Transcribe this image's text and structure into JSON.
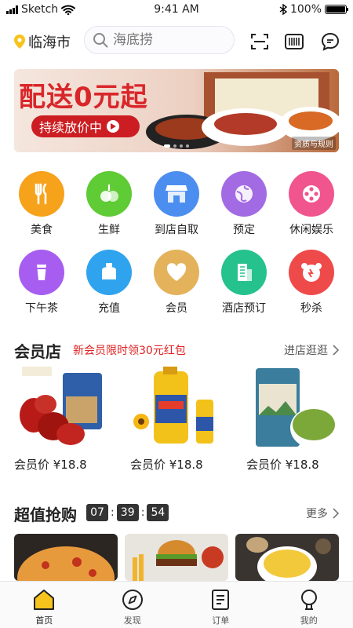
{
  "status": {
    "carrier": "Sketch",
    "time": "9:41 AM",
    "battery": "100%"
  },
  "header": {
    "city": "临海市",
    "search_placeholder": "海底捞"
  },
  "banner": {
    "title": "配送0元起",
    "subtitle": "持续放价中",
    "note": "资质与规则",
    "page_count": 4,
    "current_page": 1
  },
  "categories_row1": [
    {
      "label": "美食",
      "icon": "fork-knife-icon",
      "color": "#f7a21b"
    },
    {
      "label": "生鲜",
      "icon": "fresh-produce-icon",
      "color": "#5fcb35"
    },
    {
      "label": "到店自取",
      "icon": "storefront-icon",
      "color": "#4c8ef0"
    },
    {
      "label": "预定",
      "icon": "globe-icon",
      "color": "#a36be3"
    },
    {
      "label": "休闲娱乐",
      "icon": "film-reel-icon",
      "color": "#f0558e"
    }
  ],
  "categories_row2": [
    {
      "label": "下午茶",
      "icon": "cup-icon",
      "color": "#a75ef0"
    },
    {
      "label": "充值",
      "icon": "jar-icon",
      "color": "#30a3ee"
    },
    {
      "label": "会员",
      "icon": "heart-icon",
      "color": "#e4b25a"
    },
    {
      "label": "酒店预订",
      "icon": "building-icon",
      "color": "#26c28d"
    },
    {
      "label": "秒杀",
      "icon": "bear-alarm-icon",
      "color": "#ef4a4a"
    }
  ],
  "member_store": {
    "title": "会员店",
    "promo": "新会员限时领30元红包",
    "more": "进店逛逛",
    "products": [
      {
        "price": "会员价 ¥18.8",
        "name_icon": "red-dates-package-icon"
      },
      {
        "price": "会员价 ¥18.8",
        "name_icon": "sunflower-oil-icon"
      },
      {
        "price": "会员价 ¥18.8",
        "name_icon": "mung-beans-icon"
      }
    ]
  },
  "flash_sale": {
    "title": "超值抢购",
    "hours": "07",
    "minutes": "39",
    "seconds": "54",
    "sep": ":",
    "more": "更多"
  },
  "tabs": [
    {
      "label": "首页",
      "icon": "home-icon",
      "active": true
    },
    {
      "label": "发现",
      "icon": "compass-icon",
      "active": false
    },
    {
      "label": "订单",
      "icon": "order-list-icon",
      "active": false
    },
    {
      "label": "我的",
      "icon": "profile-icon",
      "active": false
    }
  ],
  "colors": {
    "accent": "#f7c31d",
    "brand_red": "#d9262a",
    "promo_red": "#e02020"
  }
}
